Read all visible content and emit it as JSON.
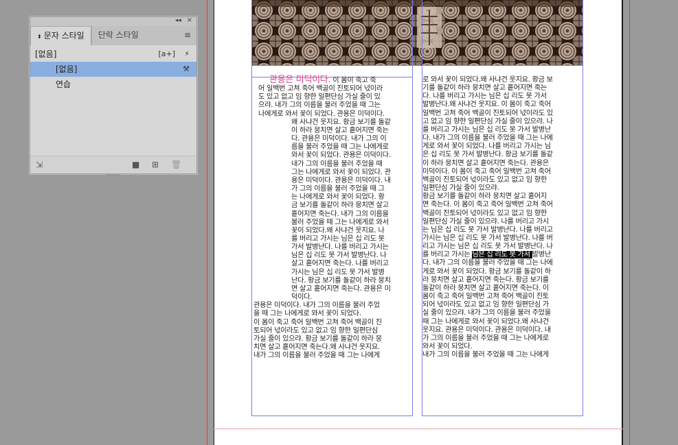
{
  "panel": {
    "tabs": [
      {
        "label": "문자 스타일",
        "active": true
      },
      {
        "label": "단락 스타일",
        "active": false
      }
    ],
    "current_style": "[없음]",
    "styles": [
      {
        "label": "[없음]",
        "selected": true
      },
      {
        "label": "연습",
        "selected": false
      }
    ],
    "icons": {
      "collapse": "double-chevron-left-icon",
      "close": "close-icon",
      "menu": "panel-menu-icon",
      "new_style_override": "[a+]",
      "quick_apply": "lightning-icon",
      "edit": "tool-icon",
      "load": "load-styles-icon",
      "folder": "folder-icon",
      "new": "new-style-icon",
      "delete": "trash-icon"
    }
  },
  "document": {
    "left_column": {
      "heading": "관용은 미덕이다.",
      "lines_top": [
        " 이 몸이 죽고 죽",
        "어 일백번 고쳐 죽어 백골이 진토되어 넋이라",
        "도 있고 없고 임 향한 일편단심 가실 줄이 있",
        "으랴. 내가 그의 이름을 불러 주었을 때 그는",
        "나에게로 와서 꽃이 되었다. 관용은 미덕이다."
      ],
      "lines_indented": [
        "왜 사냐건 웃지요. 황금 보기를 돌같",
        "이 하라 뭉치면 살고 흩어지면 죽는",
        "다. 관용은 미덕이다. 내가 그의 이",
        "름을 불러 주었을 때 그는 나에게로",
        "와서 꽃이 되었다. 관용은 미덕이다.",
        "내가 그의 이름을 불러 주었을 때",
        "그는 나에게로 와서 꽃이 되었다. 관",
        "용은 미덕이다. 관용은 미덕이다. 내",
        "가 그의 이름을 불러 주었을 때 그",
        "는 나에게로 와서 꽃이 되었다. 황",
        "금 보기를 돌같이 하라 뭉치면 살고",
        "흩어지면 죽는다. 내가 그의 이름을",
        "불러 주었을 때 그는 나에게로 와서",
        "꽃이 되었다.왜 사냐건 웃지요. 나",
        "를 버리고 가시는 님은 십 리도 못",
        "가서 발병난다. 나를 버리고 가시는",
        "님은 십 리도 못 가서 발병난다. 나",
        "살고 흩어지면 죽는다. 나를 버리고",
        "가시는 님은 십 리도 못 가서 발병",
        "난다. 황금 보기를 돌같이 하라 뭉치",
        "면 살고 흩어지면 죽는다. 관용은 미",
        "덕이다."
      ],
      "lines_bottom": [
        "관용은 미덕이다. 내가 그의 이름을 불러 주었",
        "을 때 그는 나에게로 와서 꽃이 되었다.",
        " 이 몸이 죽고 죽어 일백번 고쳐 죽어 백골이 진",
        "토되어 넋이라도 있고 없고 임 향한 일편단심",
        "가실 줄이 있으랴. 황금 보기를 돌같이 하라 뭉",
        "치면 살고 흩어지면 죽는다.왜 사냐건 웃지요.",
        "내가 그의 이름을 불러 주었을 때 그는 나에게"
      ]
    },
    "right_column": {
      "lines_a": [
        "로 와서 꽃이 되었다.왜 사냐건 웃지요. 황금 보",
        "기를 돌같이 하라 뭉치면 살고 흩어지면 죽는",
        "다. 나를 버리고 가시는 님은 십 리도 못 가서",
        "발병난다.왜 사냐건 웃지요. 이 몸이 죽고 죽어",
        "일백번 고쳐 죽어 백골이 진토되어 넋이라도 있",
        "고 없고 임 향한 일편단심 가실 줄이 있으랴. 나",
        "를 버리고 가시는 님은 십 리도 못 가서 발병난",
        "다. 내가 그의 이름을 불러 주었을 때 그는 나에",
        "게로 와서 꽃이 되었다. 나를 버리고 가시는 님",
        "은 십 리도 못 가서 발병난다. 황금 보기를 돌같",
        "이 하라 뭉치면 살고 흩어지면 죽는다. 관용은",
        "미덕이다. 이 몸이 죽고 죽어 일백번 고쳐 죽어",
        "백골이 진토되어 넋이라도 있고 없고 임 향한",
        "일편단심 가실 줄이 있으랴."
      ],
      "lines_b": [
        " 황금 보기를 돌같이 하라 뭉치면 살고 흩어지",
        "면 죽는다. 이 몸이 죽고 죽어 일백번 고쳐 죽어",
        "백골이 진토되어 넋이라도 있고 없고 임 향한",
        "일편단심 가실 줄이 있으랴. 나를 버리고 가시",
        "는 님은 십 리도 못 가서 발병난다. 나를 버리고",
        "가시는 님은 십 리도 못 가서 발병난다. 나를 버",
        "리고 가시는 님은 십 리도 못 가서 발병난다. 나"
      ],
      "highlight_line": {
        "before": "를 버리고 가시는 ",
        "selected": "님은 십 리도 못 가서 ",
        "after": "발병난"
      },
      "lines_c": [
        "다. 내가 그의 이름을 불러 주었을 때 그는 나에",
        "게로 와서 꽃이 되었다. 황금 보기를 돌같이 하",
        "라 뭉치면 살고 흩어지면 죽는다. 황금 보기를",
        "돌같이 하라 뭉치면 살고 흩어지면 죽는다. 이",
        "몸이 죽고 죽어 일백번 고쳐 죽어 백골이 진토",
        "되어 넋이라도 있고 없고 임 향한 일편단심 가",
        "실 줄이 있으랴. 내가 그의 이름을 불러 주었을",
        "때 그는 나에게로 와서 꽃이 되었다.왜 사냐건",
        "웃지요. 관용은 미덕이다. 관용은 미덕이다. 내",
        "가 그의 이름을 불러 주었을 때 그는 나에게로",
        "와서 꽃이 되었다.",
        " 내가 그의 이름을 불러 주었을 때 그는 나에게"
      ]
    }
  },
  "colors": {
    "selection": "#8aaee0",
    "heading": "#e0408a",
    "frame": "#7b7be6",
    "guide": "#e0403a"
  }
}
